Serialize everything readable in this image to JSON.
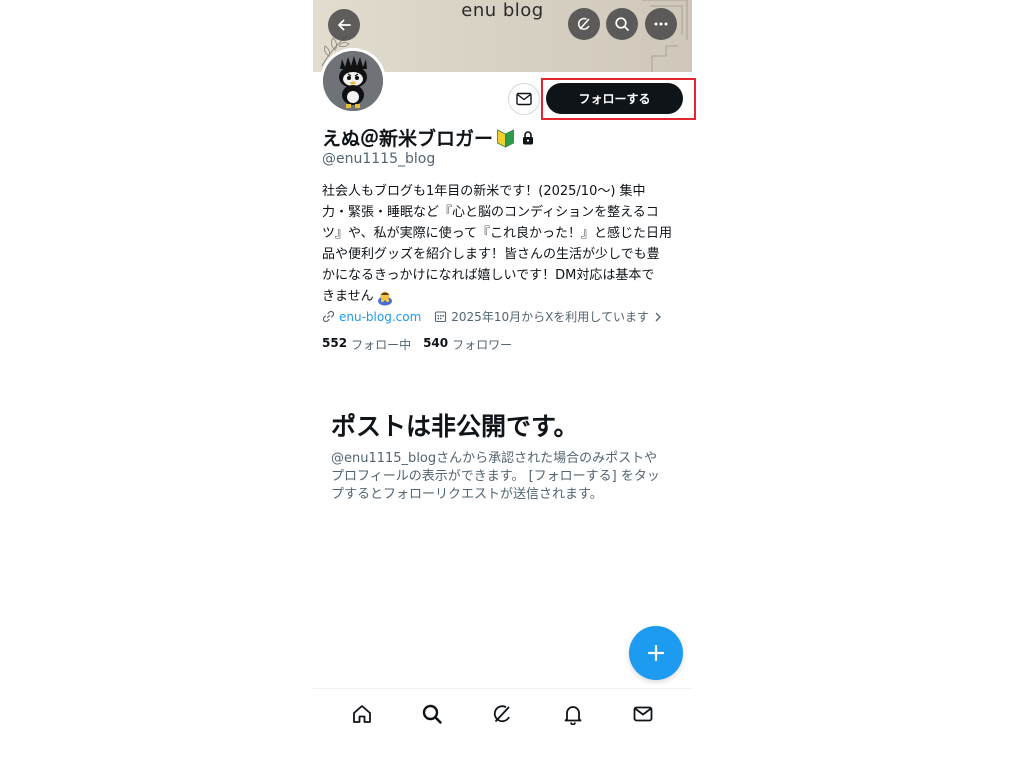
{
  "banner": {
    "title": "enu blog"
  },
  "header_actions": {
    "back": "back-arrow-icon",
    "grok": "grok-icon",
    "search": "search-icon",
    "more": "more-icon"
  },
  "profile": {
    "follow_label": "フォローする",
    "name": "えぬ＠新米ブロガー",
    "handle": "@enu1115_blog",
    "bio_lines": [
      "社会人もブログも1年目の新米です！(2025/10〜) 集中",
      "力・緊張・睡眠など『心と脳のコンディションを整えるコ",
      "ツ』や、私が実際に使って『これ良かった！』と感じた日用",
      "品や便利グッズを紹介します！皆さんの生活が少しでも豊",
      "かになるきっかけになれば嬉しいです！DM対応は基本で",
      "きません"
    ],
    "website": "enu-blog.com",
    "joined": "2025年10月からXを利用しています",
    "following_count": "552",
    "following_label": "フォロー中",
    "followers_count": "540",
    "followers_label": "フォロワー"
  },
  "private": {
    "title": "ポストは非公開です。",
    "desc_lines": [
      "@enu1115_blogさんから承認された場合のみポストや",
      "プロフィールの表示ができます。 [フォローする] をタッ",
      "プするとフォローリクエストが送信されます。"
    ]
  },
  "colors": {
    "accent": "#1d9bf0",
    "follow_bg": "#0f1419",
    "highlight": "#e3262f",
    "muted": "#536471"
  },
  "tabs": [
    "home-icon",
    "search-icon",
    "grok-icon",
    "notifications-icon",
    "messages-icon"
  ]
}
